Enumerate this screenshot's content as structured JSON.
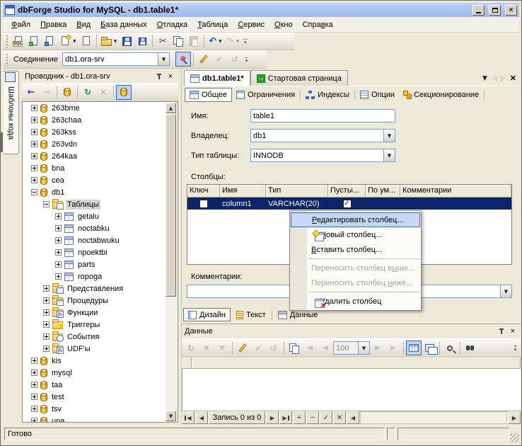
{
  "colors": {
    "titlebar": "#aac4f2",
    "selection": "#0b246b",
    "menu_highlight": "#c6d7f5",
    "toggle_bg": "#c1d2ee",
    "toggle_border": "#316ac5"
  },
  "window": {
    "title": "dbForge Studio for MySQL - db1.table1*"
  },
  "menu_bar": {
    "items": [
      {
        "pre": "",
        "u": "Ф",
        "post": "айл"
      },
      {
        "pre": "",
        "u": "П",
        "post": "равка"
      },
      {
        "pre": "",
        "u": "В",
        "post": "ид"
      },
      {
        "pre": "",
        "u": "Б",
        "post": "аза данных"
      },
      {
        "pre": "",
        "u": "О",
        "post": "тладка"
      },
      {
        "pre": "",
        "u": "Т",
        "post": "аблица"
      },
      {
        "pre": "",
        "u": "С",
        "post": "ервис"
      },
      {
        "pre": "",
        "u": "О",
        "post": "кно"
      },
      {
        "pre": "Спра",
        "u": "в",
        "post": "ка"
      }
    ]
  },
  "toolbar_main": {
    "sql_badge": "SQL"
  },
  "toolbar_connection": {
    "label": "Соединение",
    "value": "db1.ora-srv"
  },
  "code_templates_tab": {
    "label": "Шаблоны кода"
  },
  "explorer": {
    "title": "Проводник - db1.ora-srv",
    "tree": {
      "items": [
        {
          "lvl": "lvl1",
          "exp": "exp-plus",
          "icon": "ic-db",
          "label": "263bme",
          "sel": ""
        },
        {
          "lvl": "lvl1",
          "exp": "exp-plus",
          "icon": "ic-db",
          "label": "263chaa",
          "sel": ""
        },
        {
          "lvl": "lvl1",
          "exp": "exp-plus",
          "icon": "ic-db",
          "label": "263kss",
          "sel": ""
        },
        {
          "lvl": "lvl1",
          "exp": "exp-plus",
          "icon": "ic-db",
          "label": "263vdn",
          "sel": ""
        },
        {
          "lvl": "lvl1",
          "exp": "exp-plus",
          "icon": "ic-db",
          "label": "264kaa",
          "sel": ""
        },
        {
          "lvl": "lvl1",
          "exp": "exp-plus",
          "icon": "ic-db",
          "label": "bna",
          "sel": ""
        },
        {
          "lvl": "lvl1",
          "exp": "exp-plus",
          "icon": "ic-db",
          "label": "cea",
          "sel": ""
        },
        {
          "lvl": "lvl1",
          "exp": "exp-minus",
          "icon": "ic-db",
          "label": "db1",
          "sel": ""
        },
        {
          "lvl": "lvl2",
          "exp": "exp-minus",
          "icon": "ic-folder f-table",
          "label": "Таблицы",
          "sel": "sel"
        },
        {
          "lvl": "lvl3",
          "exp": "exp-plus",
          "icon": "ic-table",
          "label": "getalu",
          "sel": ""
        },
        {
          "lvl": "lvl3",
          "exp": "exp-plus",
          "icon": "ic-table",
          "label": "noctabku",
          "sel": ""
        },
        {
          "lvl": "lvl3",
          "exp": "exp-plus",
          "icon": "ic-table",
          "label": "noctabwuku",
          "sel": ""
        },
        {
          "lvl": "lvl3",
          "exp": "exp-plus",
          "icon": "ic-table",
          "label": "npoektbi",
          "sel": ""
        },
        {
          "lvl": "lvl3",
          "exp": "exp-plus",
          "icon": "ic-table",
          "label": "parts",
          "sel": ""
        },
        {
          "lvl": "lvl3",
          "exp": "exp-plus",
          "icon": "ic-table",
          "label": "ropoga",
          "sel": ""
        },
        {
          "lvl": "lvl2",
          "exp": "exp-plus",
          "icon": "ic-folder f-view",
          "label": "Представления",
          "sel": ""
        },
        {
          "lvl": "lvl2",
          "exp": "exp-plus",
          "icon": "ic-folder f-proc",
          "label": "Процедуры",
          "sel": ""
        },
        {
          "lvl": "lvl2",
          "exp": "exp-plus",
          "icon": "ic-folder f-func",
          "label": "Функции",
          "sel": ""
        },
        {
          "lvl": "lvl2",
          "exp": "exp-plus",
          "icon": "ic-folder f-trig",
          "label": "Триггеры",
          "sel": ""
        },
        {
          "lvl": "lvl2",
          "exp": "exp-plus",
          "icon": "ic-folder f-event",
          "label": "События",
          "sel": ""
        },
        {
          "lvl": "lvl2",
          "exp": "exp-plus",
          "icon": "ic-folder f-udf",
          "label": "UDF'ы",
          "sel": ""
        },
        {
          "lvl": "lvl1",
          "exp": "exp-plus",
          "icon": "ic-db",
          "label": "kis",
          "sel": ""
        },
        {
          "lvl": "lvl1",
          "exp": "exp-plus",
          "icon": "ic-db",
          "label": "mysql",
          "sel": ""
        },
        {
          "lvl": "lvl1",
          "exp": "exp-plus",
          "icon": "ic-db",
          "label": "taa",
          "sel": ""
        },
        {
          "lvl": "lvl1",
          "exp": "exp-plus",
          "icon": "ic-db",
          "label": "test",
          "sel": ""
        },
        {
          "lvl": "lvl1",
          "exp": "exp-plus",
          "icon": "ic-db",
          "label": "tsv",
          "sel": ""
        },
        {
          "lvl": "lvl1",
          "exp": "exp-plus",
          "icon": "ic-db",
          "label": "upa",
          "sel": ""
        }
      ]
    }
  },
  "document_tabs": {
    "tabs": [
      {
        "label": "db1.table1*"
      },
      {
        "label": "Стартовая страница"
      }
    ]
  },
  "editor_tabs": {
    "items": [
      {
        "label": "Общее"
      },
      {
        "label": "Ограничения"
      },
      {
        "label": "Индексы"
      },
      {
        "label": "Опции"
      },
      {
        "label": "Секционирование"
      }
    ]
  },
  "general_form": {
    "name_label": "Имя:",
    "name_value": "table1",
    "owner_label": "Владелец:",
    "owner_value": "db1",
    "type_label": "Тип таблицы:",
    "type_value": "INNODB",
    "columns_label": "Столбцы:",
    "comments_label": "Комментарии:",
    "comments_value": ""
  },
  "columns_grid": {
    "headers": [
      "Ключ",
      "Имя",
      "Тип",
      "Пусты...",
      "По ум...",
      "Комментарии"
    ],
    "row": {
      "name": "column1",
      "type": "VARCHAR(20)",
      "key_checked": false,
      "nullable_checked": true,
      "default": "",
      "comments": ""
    }
  },
  "context_menu": {
    "items": [
      {
        "pre": "",
        "u": "Р",
        "post": "едактировать столбец..."
      },
      {
        "pre": "",
        "u": "Н",
        "post": "овый столбец..."
      },
      {
        "pre": "",
        "u": "В",
        "post": "ставить столбец..."
      },
      {
        "separator": true
      },
      {
        "pre": "Переносить столбец в",
        "u": "ы",
        "post": "ше..."
      },
      {
        "pre": "Переносить столбец ",
        "u": "н",
        "post": "иже..."
      },
      {
        "separator": true
      },
      {
        "pre": "",
        "u": "У",
        "post": "далить столбец"
      }
    ]
  },
  "view_tabs": {
    "items": [
      {
        "label": "Дизайн"
      },
      {
        "label": "Текст"
      },
      {
        "label": "Данные"
      }
    ]
  },
  "data_panel": {
    "title": "Данные",
    "page_size": "100",
    "record_label": "Запись 0 из 0"
  },
  "status_bar": {
    "text": "Готово"
  }
}
